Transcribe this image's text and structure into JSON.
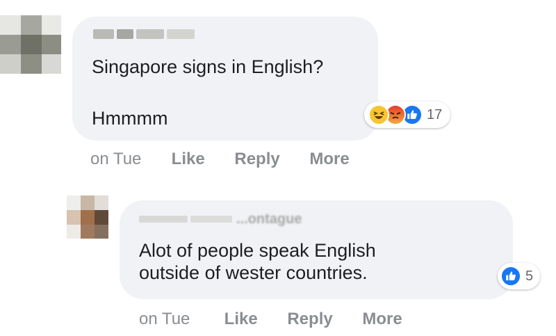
{
  "comments": [
    {
      "text_lines": [
        "Singapore signs in English?",
        "",
        "Hmmmm"
      ],
      "reactions": {
        "icons": [
          "haha-icon",
          "angry-icon",
          "like-icon"
        ],
        "count": "17"
      },
      "actions": {
        "time": "on Tue",
        "like": "Like",
        "reply": "Reply",
        "more": "More"
      }
    },
    {
      "author_partial": "...ontague",
      "text_lines": [
        "Alot of people speak English",
        "outside of wester countries."
      ],
      "reactions": {
        "icons": [
          "like-icon"
        ],
        "count": "5"
      },
      "actions": {
        "time": "on Tue",
        "like": "Like",
        "reply": "Reply",
        "more": "More"
      }
    }
  ],
  "colors": {
    "bubble": "#f0f2f5",
    "like_blue": "#1877f2",
    "haha_yellow": "#f7c531",
    "angry_red": "#e9710f",
    "muted_text": "#8a8d91"
  }
}
